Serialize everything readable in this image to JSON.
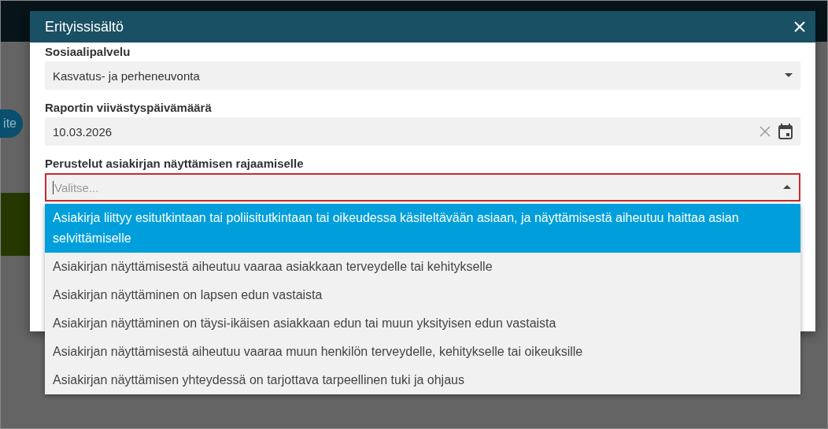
{
  "background": {
    "button": "ite"
  },
  "dialog": {
    "title": "Erityissisältö",
    "fields": [
      {
        "kind": "select",
        "label": "Sosiaalipalvelu",
        "value": "Kasvatus- ja perheneuvonta"
      },
      {
        "kind": "date",
        "label": "Raportin viivästyspäivämäärä",
        "value": "10.03.2026"
      },
      {
        "kind": "combo",
        "label": "Perustelut asiakirjan näyttämisen rajaamiselle",
        "placeholder": "Valitse...",
        "invalid": true,
        "expanded": true,
        "options": [
          {
            "label": "Asiakirja liittyy esitutkintaan tai poliisitutkintaan tai oikeudessa käsiteltävään asiaan, ja näyttämisestä aiheutuu haittaa asian selvittämiselle",
            "selected": true
          },
          {
            "label": "Asiakirjan näyttämisestä aiheutuu vaaraa asiakkaan terveydelle tai kehitykselle",
            "selected": false
          },
          {
            "label": "Asiakirjan näyttäminen on lapsen edun vastaista",
            "selected": false
          },
          {
            "label": "Asiakirjan näyttäminen on täysi-ikäisen asiakkaan edun tai muun yksityisen edun vastaista",
            "selected": false
          },
          {
            "label": "Asiakirjan näyttämisestä aiheutuu vaaraa muun henkilön terveydelle, kehitykselle tai oikeuksille",
            "selected": false
          },
          {
            "label": "Asiakirjan näyttämisen yhteydessä on tarjottava tarpeellinen tuki ja ohjaus",
            "selected": false
          }
        ]
      }
    ]
  }
}
